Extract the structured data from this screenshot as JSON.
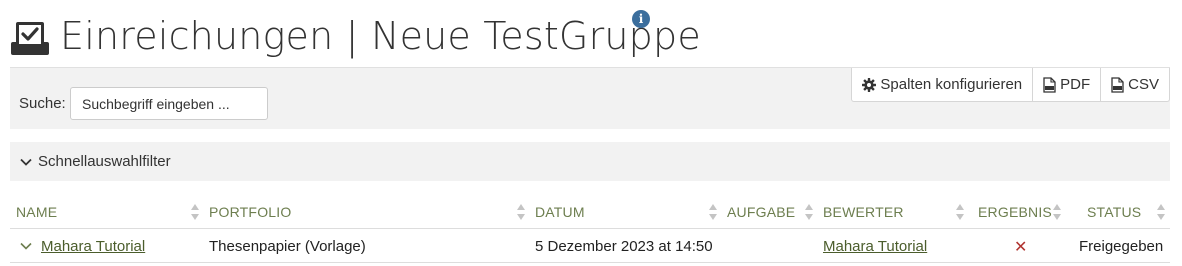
{
  "header": {
    "title": "Einreichungen | Neue TestGruppe",
    "title_icon": "inbox-check-icon",
    "info_icon": "info-icon",
    "info_symbol": "i"
  },
  "toolbar": {
    "search_label": "Suche:",
    "search_placeholder": "Suchbegriff eingeben ...",
    "search_value": "",
    "buttons": [
      {
        "label": "Spalten konfigurieren",
        "icon": "gear-icon"
      },
      {
        "label": "PDF",
        "icon": "pdf-file-icon"
      },
      {
        "label": "CSV",
        "icon": "csv-file-icon"
      }
    ]
  },
  "filter": {
    "label": "Schnellauswahlfilter",
    "icon": "chevron-down-icon"
  },
  "table": {
    "columns": [
      "NAME",
      "PORTFOLIO",
      "DATUM",
      "AUFGABE",
      "BEWERTER",
      "ERGEBNIS",
      "STATUS"
    ],
    "rows": [
      {
        "name": "Mahara Tutorial",
        "portfolio": "Thesenpapier (Vorlage)",
        "datum": "5 Dezember 2023 at 14:50",
        "aufgabe": "",
        "bewerter": "Mahara Tutorial",
        "ergebnis": "✕",
        "status": "Freigegeben"
      }
    ]
  },
  "colors": {
    "link": "#4b5d2c",
    "header_text": "#6d7e4f",
    "info": "#3b6e9d",
    "fail": "#b0332f",
    "panel_bg": "#f2f2f2"
  }
}
